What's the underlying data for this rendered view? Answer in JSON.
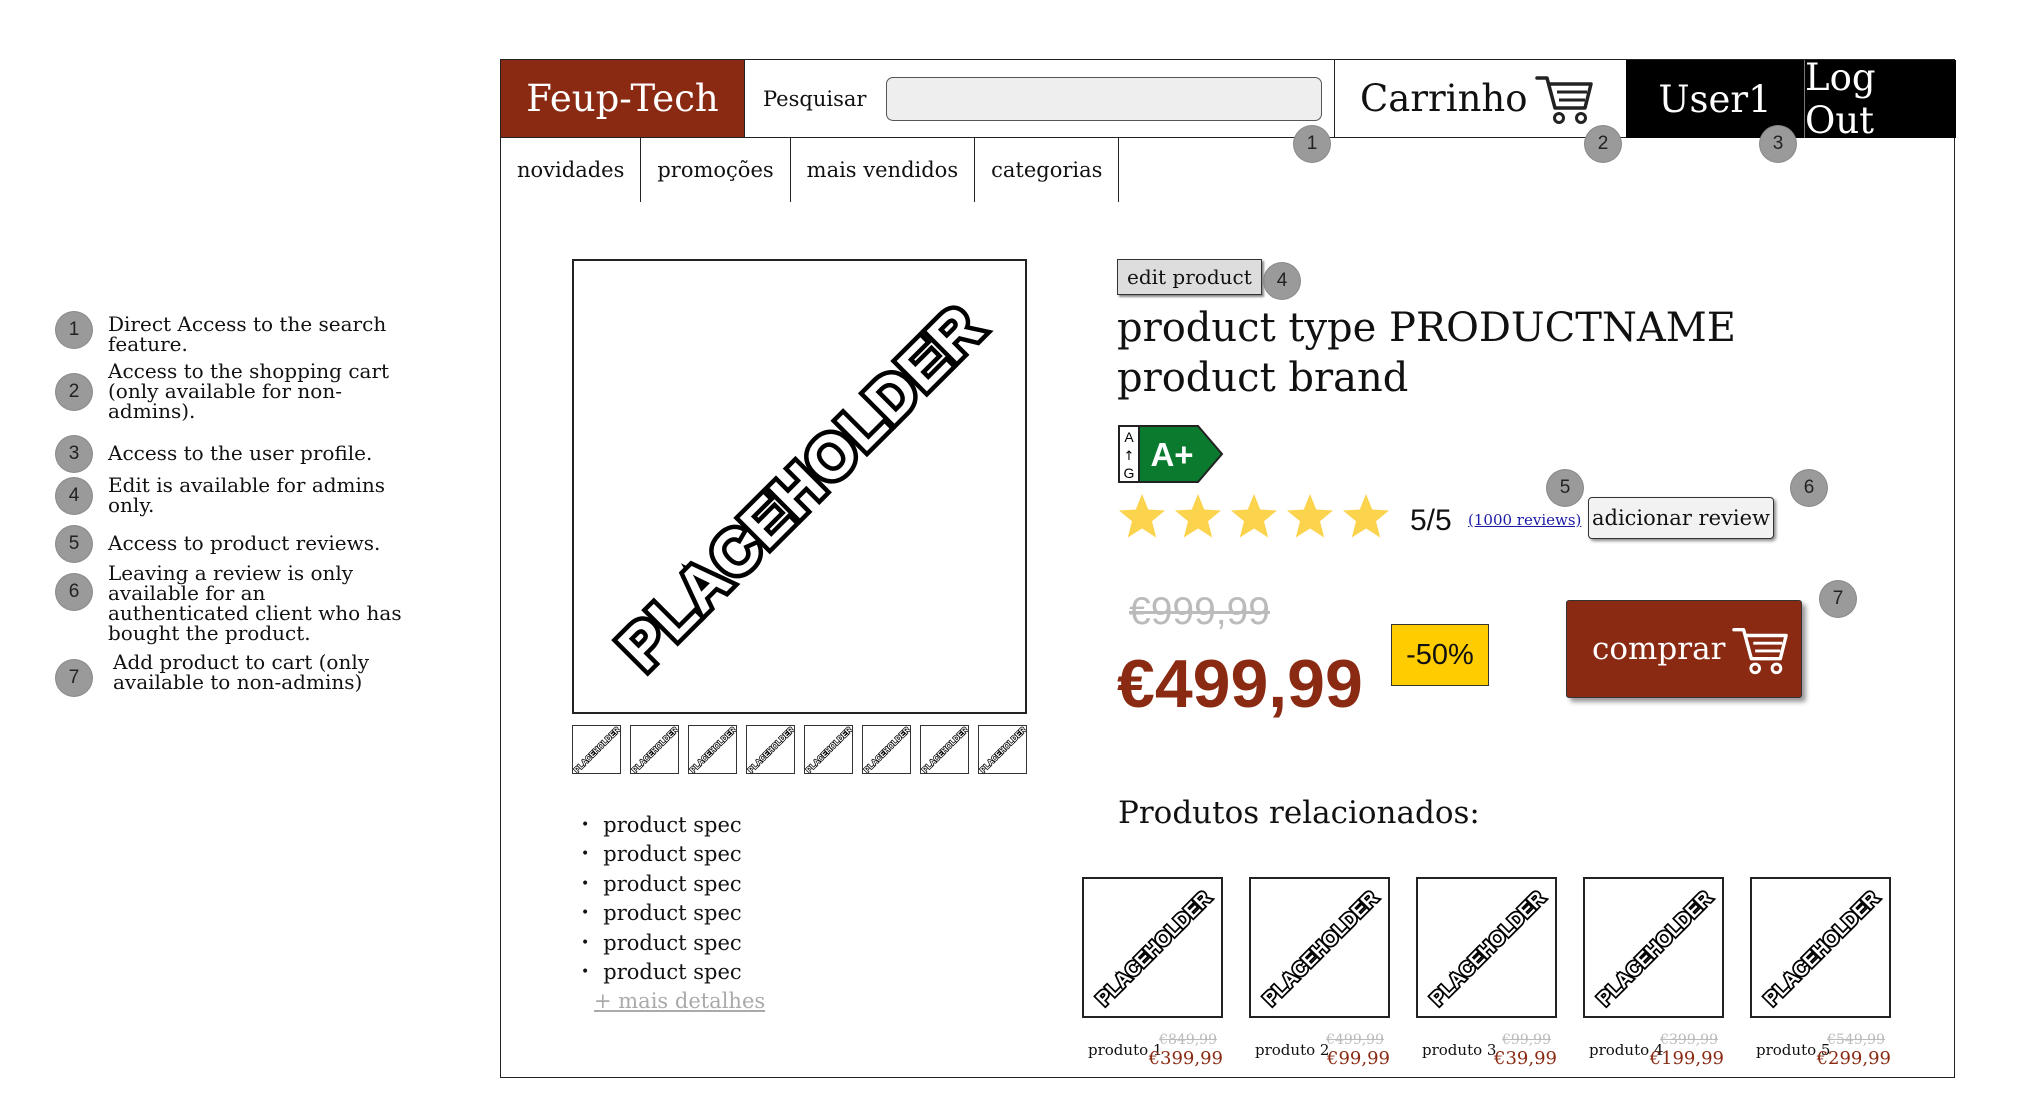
{
  "legend": [
    {
      "n": "1",
      "text": "Direct Access to the search feature."
    },
    {
      "n": "2",
      "text": "Access to the shopping cart (only available for non-admins)."
    },
    {
      "n": "3",
      "text": "Access to the user profile."
    },
    {
      "n": "4",
      "text": "Edit is available for admins only."
    },
    {
      "n": "5",
      "text": "Access to product reviews."
    },
    {
      "n": "6",
      "text": "Leaving a review is only available for an authenticated client who has bought the product."
    },
    {
      "n": "7",
      "text": "Add product to cart (only available to non-admins)"
    }
  ],
  "header": {
    "brand": "Feup-Tech",
    "search_label": "Pesquisar",
    "search_value": "",
    "cart_label": "Carrinho",
    "user_label": "User1",
    "logout_label": "Log Out"
  },
  "badges": {
    "b1": "1",
    "b2": "2",
    "b3": "3",
    "b4": "4",
    "b5": "5",
    "b6": "6",
    "b7": "7"
  },
  "nav": {
    "tabs": [
      "novidades",
      "promoções",
      "mais vendidos",
      "categorias"
    ]
  },
  "placeholder_text": "PLACEHOLDER",
  "product": {
    "edit_label": "edit product",
    "title_line1": "product type PRODUCTNAME",
    "title_line2": "product brand",
    "energy_scale_top": "A",
    "energy_scale_arrow": "↑",
    "energy_scale_bottom": "G",
    "energy_class": "A+",
    "energy_color": "#0a7a2e",
    "rating_stars": 5,
    "rating_text": "5/5",
    "reviews_link": "(1000 reviews)",
    "add_review_label": "adicionar review",
    "old_price": "€999,99",
    "price": "€499,99",
    "discount": "-50%",
    "buy_label": "comprar",
    "specs": [
      "product spec",
      "product spec",
      "product spec",
      "product spec",
      "product spec",
      "product spec"
    ],
    "more_details": "+ mais detalhes"
  },
  "related": {
    "title": "Produtos relacionados:",
    "items": [
      {
        "name": "produto 1",
        "old": "€849,99",
        "price": "€399,99"
      },
      {
        "name": "produto 2",
        "old": "€499,99",
        "price": "€99,99"
      },
      {
        "name": "produto 3",
        "old": "€99,99",
        "price": "€39,99"
      },
      {
        "name": "produto 4",
        "old": "€399,99",
        "price": "€199,99"
      },
      {
        "name": "produto 5",
        "old": "€549,99",
        "price": "€299,99"
      }
    ]
  },
  "colors": {
    "brand": "#8a2a12",
    "star": "#fcd34d",
    "discount_bg": "#ffcc00"
  }
}
